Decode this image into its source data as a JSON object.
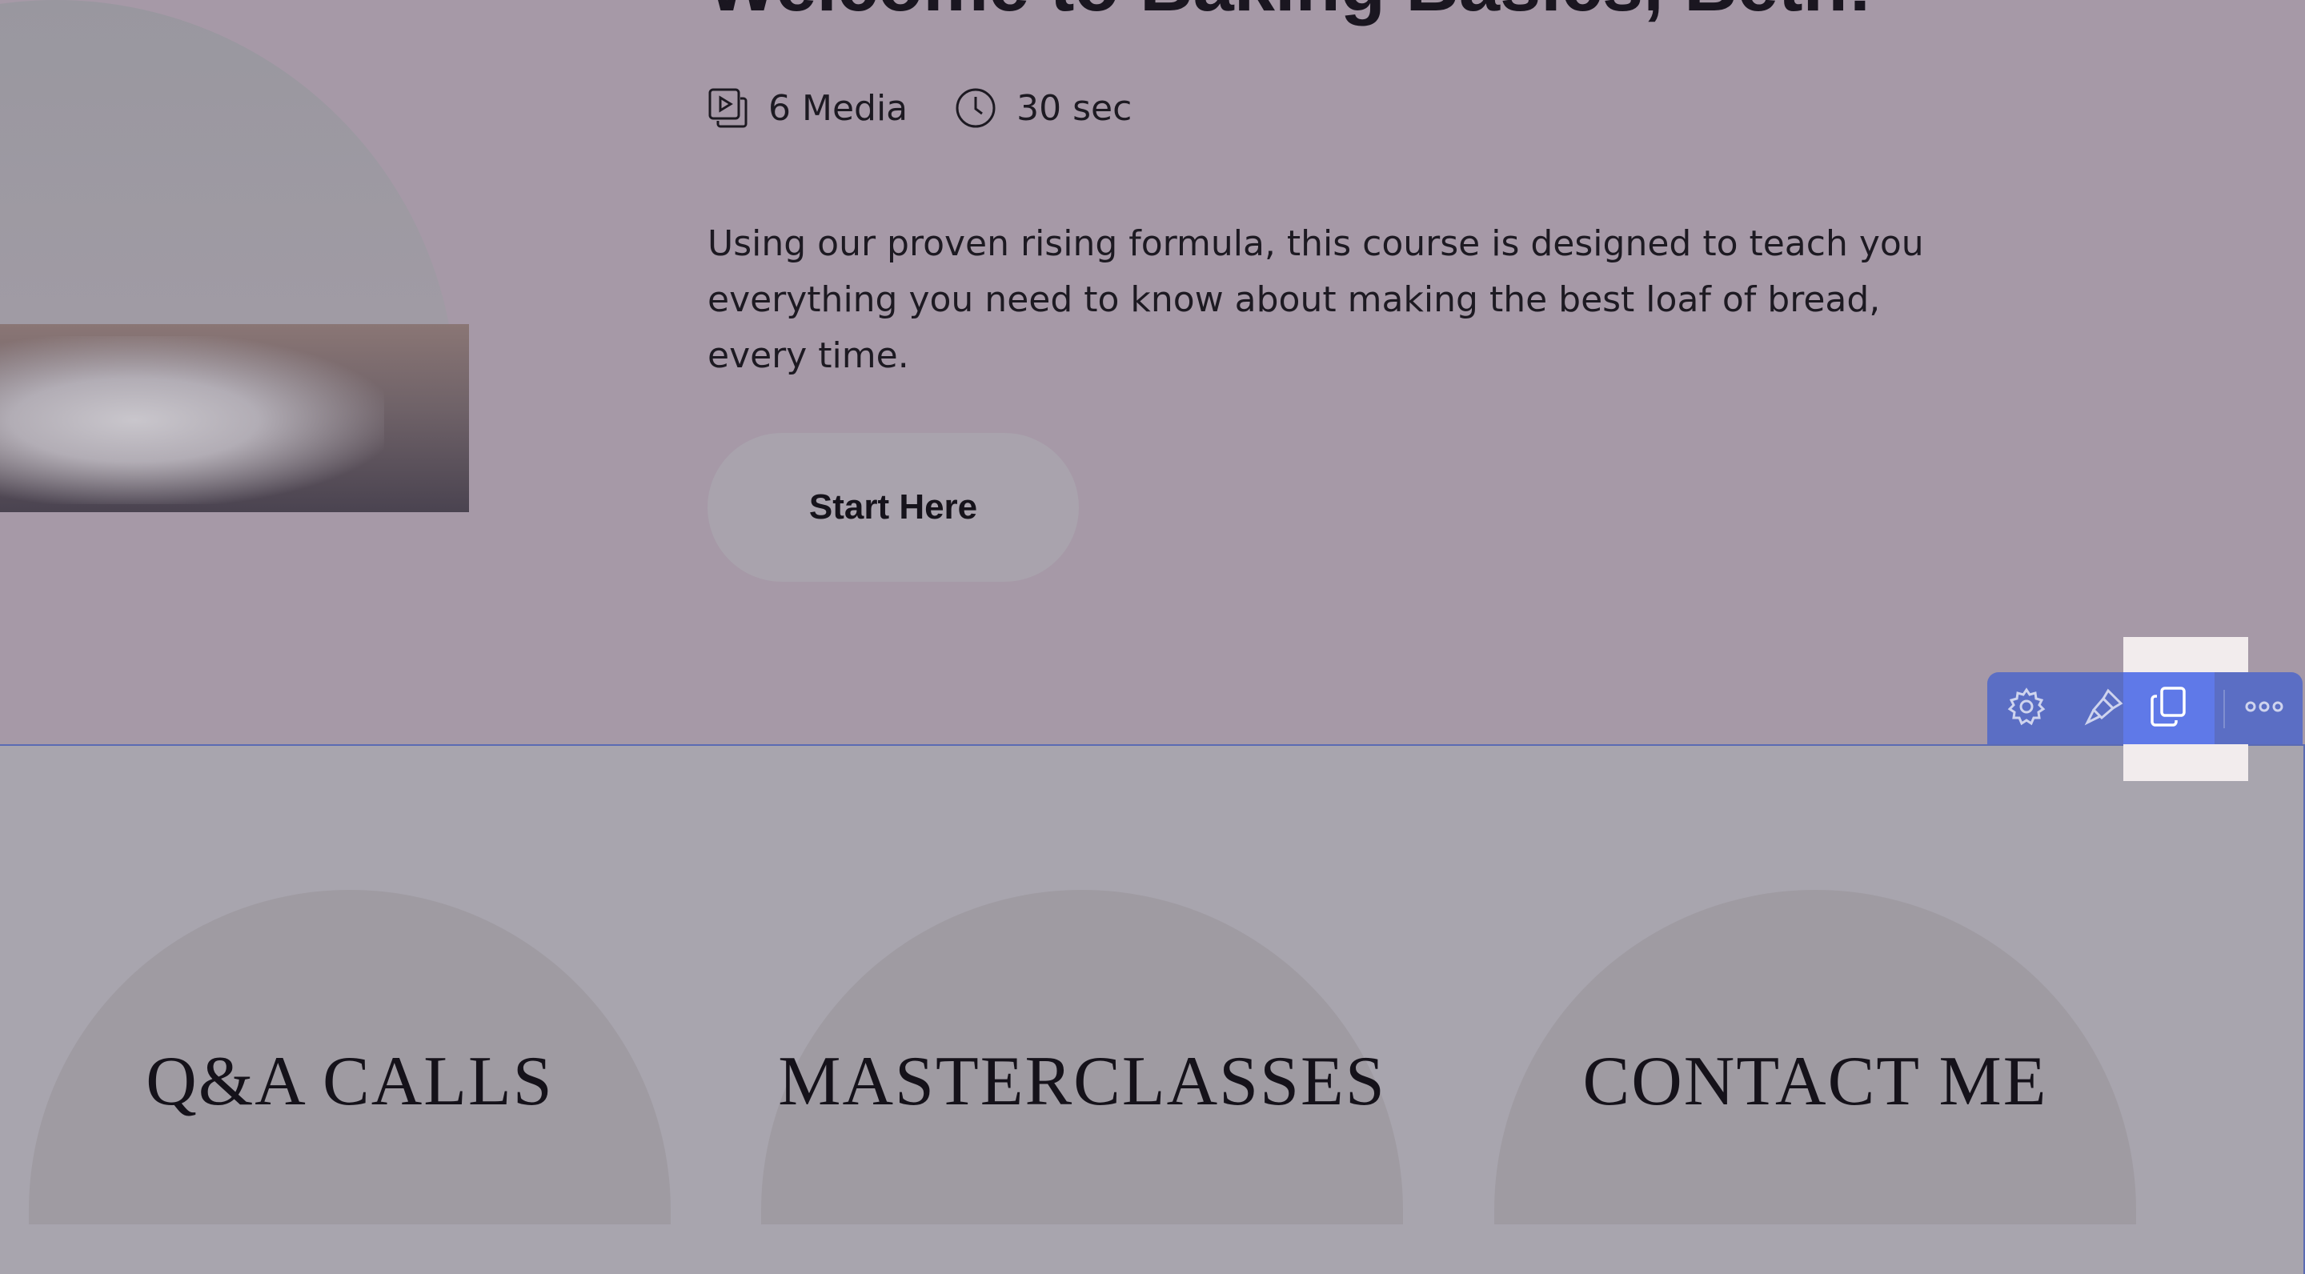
{
  "hero": {
    "title": "Welcome to Baking Basics, Beth!",
    "media_count": "6 Media",
    "duration": "30 sec",
    "description": "Using our proven rising formula, this course is designed to teach you everything you need to know about making the best loaf of bread, every time.",
    "cta_label": "Start Here"
  },
  "cards": [
    {
      "label": "Q&A CALLS"
    },
    {
      "label": "MASTERCLASSES"
    },
    {
      "label": "CONTACT ME"
    }
  ],
  "toolbar": {
    "icons": [
      "gear-icon",
      "paintbrush-icon",
      "duplicate-icon",
      "more-icon"
    ]
  },
  "colors": {
    "overlay": "#a699a7",
    "section_bg": "#a8a5ae",
    "card_bg": "#9f9ba2",
    "toolbar_bg": "#5b6ec4",
    "selection_border": "#5b6bb3"
  }
}
